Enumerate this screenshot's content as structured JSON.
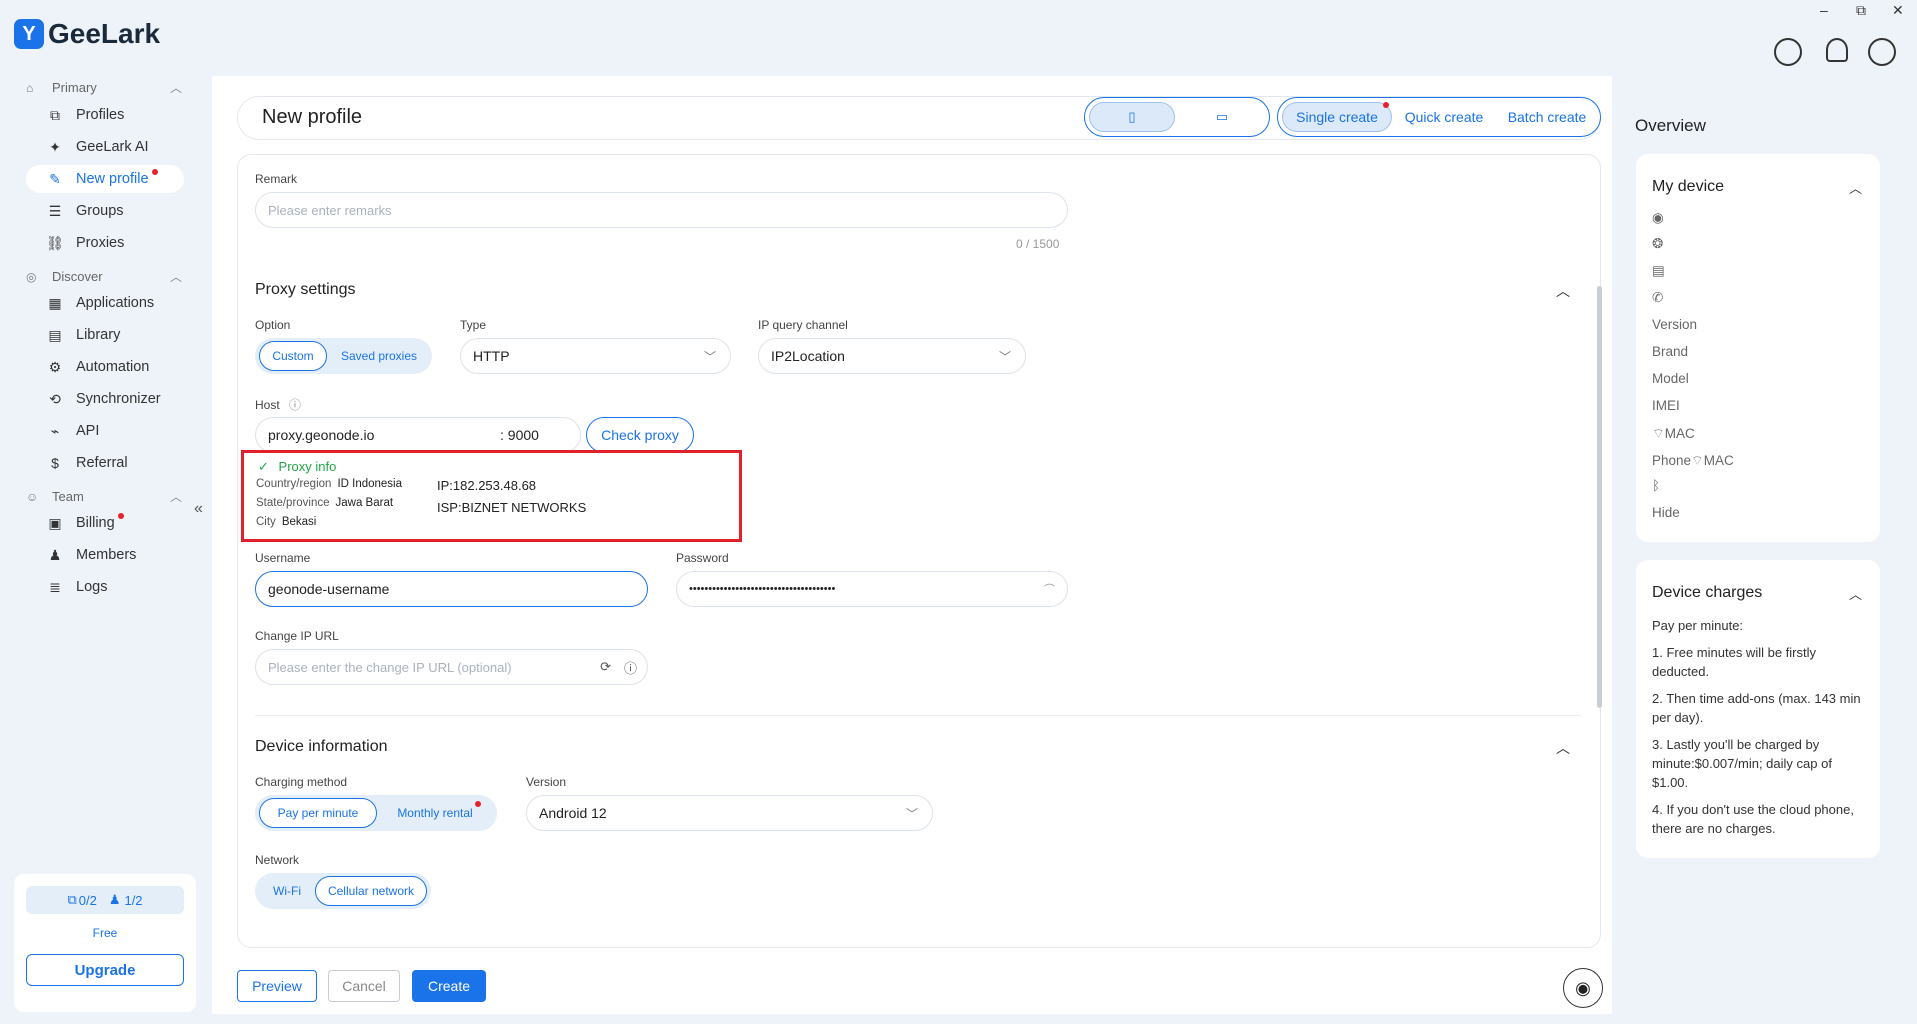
{
  "app": {
    "logo_text": "GeeLark",
    "logo_mark": "Y",
    "brand_color": "#1a73e8"
  },
  "window_controls": {
    "minimize": "–",
    "maximize": "⧉",
    "close": "✕"
  },
  "sidebar": {
    "sections": [
      {
        "label": "Primary",
        "icon": "home-icon"
      },
      {
        "label": "Discover",
        "icon": "compass-icon"
      },
      {
        "label": "Team",
        "icon": "team-icon"
      }
    ],
    "items": [
      {
        "label": "Profiles",
        "icon": "profiles-icon",
        "glyph": "⧉"
      },
      {
        "label": "GeeLark AI",
        "icon": "ai-icon",
        "glyph": "✦"
      },
      {
        "label": "New profile",
        "icon": "edit-icon",
        "glyph": "✎",
        "active": true
      },
      {
        "label": "Groups",
        "icon": "list-icon",
        "glyph": "☰"
      },
      {
        "label": "Proxies",
        "icon": "proxy-icon",
        "glyph": "⛓"
      },
      {
        "label": "Applications",
        "icon": "grid-icon",
        "glyph": "▦"
      },
      {
        "label": "Library",
        "icon": "library-icon",
        "glyph": "▤"
      },
      {
        "label": "Automation",
        "icon": "robot-icon",
        "glyph": "⚙"
      },
      {
        "label": "Synchronizer",
        "icon": "sync-icon",
        "glyph": "⟲"
      },
      {
        "label": "API",
        "icon": "api-icon",
        "glyph": "⌁"
      },
      {
        "label": "Referral",
        "icon": "dollar-icon",
        "glyph": "$"
      },
      {
        "label": "Billing",
        "icon": "billing-icon",
        "glyph": "▣"
      },
      {
        "label": "Members",
        "icon": "person-icon",
        "glyph": "♟"
      },
      {
        "label": "Logs",
        "icon": "logs-icon",
        "glyph": "≣"
      }
    ],
    "collapse": "«",
    "plan": {
      "profiles": "0/2",
      "members": "1/2",
      "tier": "Free",
      "upgrade": "Upgrade"
    }
  },
  "header": {
    "title": "New profile",
    "device_types": [
      "phone-icon",
      "laptop-icon"
    ],
    "device_glyphs": [
      "▯",
      "▭"
    ],
    "tabs": [
      "Single create",
      "Quick create",
      "Batch create"
    ]
  },
  "form": {
    "remark": {
      "label": "Remark",
      "placeholder": "Please enter remarks",
      "counter": "0 / 1500"
    },
    "proxy": {
      "title": "Proxy settings",
      "option_label": "Option",
      "options": [
        "Custom",
        "Saved proxies"
      ],
      "type_label": "Type",
      "type_value": "HTTP",
      "channel_label": "IP query channel",
      "channel_value": "IP2Location",
      "host_label": "Host",
      "host_value": "proxy.geonode.io",
      "port_value": ": 9000",
      "check_button": "Check proxy",
      "info": {
        "title": "Proxy info",
        "country_key": "Country/region",
        "country_val": "ID Indonesia",
        "state_key": "State/province",
        "state_val": "Jawa Barat",
        "city_key": "City",
        "city_val": "Bekasi",
        "ip": "IP:182.253.48.68",
        "isp": "ISP:BIZNET NETWORKS"
      },
      "username_label": "Username",
      "username_value": "geonode-username",
      "password_label": "Password",
      "password_value": "••••••••••••••••••••••••••••••••••••••",
      "change_ip_label": "Change IP URL",
      "change_ip_placeholder": "Please enter the change IP URL (optional)"
    },
    "device": {
      "title": "Device information",
      "charging_label": "Charging method",
      "charging_options": [
        "Pay per minute",
        "Monthly rental"
      ],
      "version_label": "Version",
      "version_value": "Android 12",
      "network_label": "Network",
      "network_options": [
        "Wi-Fi",
        "Cellular network"
      ]
    }
  },
  "footer": {
    "preview": "Preview",
    "cancel": "Cancel",
    "create": "Create"
  },
  "overview": {
    "title": "Overview",
    "my_device": {
      "title": "My device",
      "icon_rows": [
        "location-icon",
        "fingerprint-icon",
        "sim-icon",
        "phone-call-icon"
      ],
      "rows": [
        "Version",
        "Brand",
        "Model",
        "IMEI",
        "MAC",
        "Phone",
        "MAC",
        "Hide"
      ]
    },
    "charges": {
      "title": "Device charges",
      "heading": "Pay per minute:",
      "lines": [
        "1. Free minutes will be firstly deducted.",
        "2. Then time add-ons (max. 143 min per day).",
        "3. Lastly you'll be charged by minute:$0.007/min; daily cap of $1.00.",
        "4. If you don't use the cloud phone, there are no charges."
      ]
    }
  }
}
